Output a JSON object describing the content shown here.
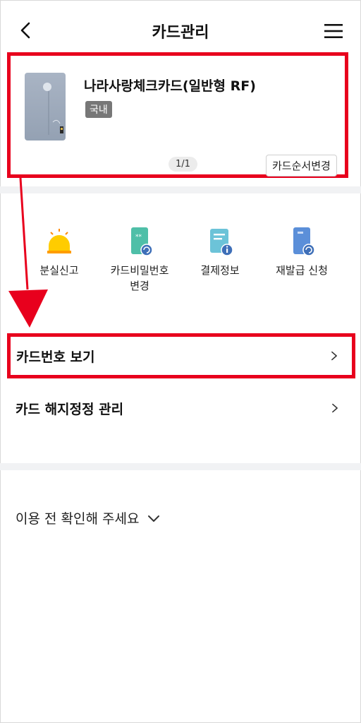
{
  "header": {
    "title": "카드관리",
    "back_icon": "chevron-left-icon",
    "menu_icon": "hamburger-menu-icon"
  },
  "card": {
    "name": "나라사랑체크카드(일반형 RF)",
    "badge": "국내",
    "pager": "1/1",
    "order_button": "카드순서변경"
  },
  "quick_menu": [
    {
      "label": "분실신고",
      "icon": "siren-icon"
    },
    {
      "label": "카드비밀번호\n변경",
      "icon": "card-password-change-icon"
    },
    {
      "label": "결제정보",
      "icon": "payment-info-icon"
    },
    {
      "label": "재발급 신청",
      "icon": "reissue-icon"
    }
  ],
  "list": {
    "card_number": "카드번호 보기",
    "termination": "카드 해지정정 관리"
  },
  "notice": {
    "label": "이용 전 확인해 주세요"
  },
  "colors": {
    "highlight": "#e8001d",
    "siren": "#ffcc00",
    "teal": "#4fbfa8",
    "cyan": "#6cc3d8",
    "blue": "#5b8fd9"
  }
}
